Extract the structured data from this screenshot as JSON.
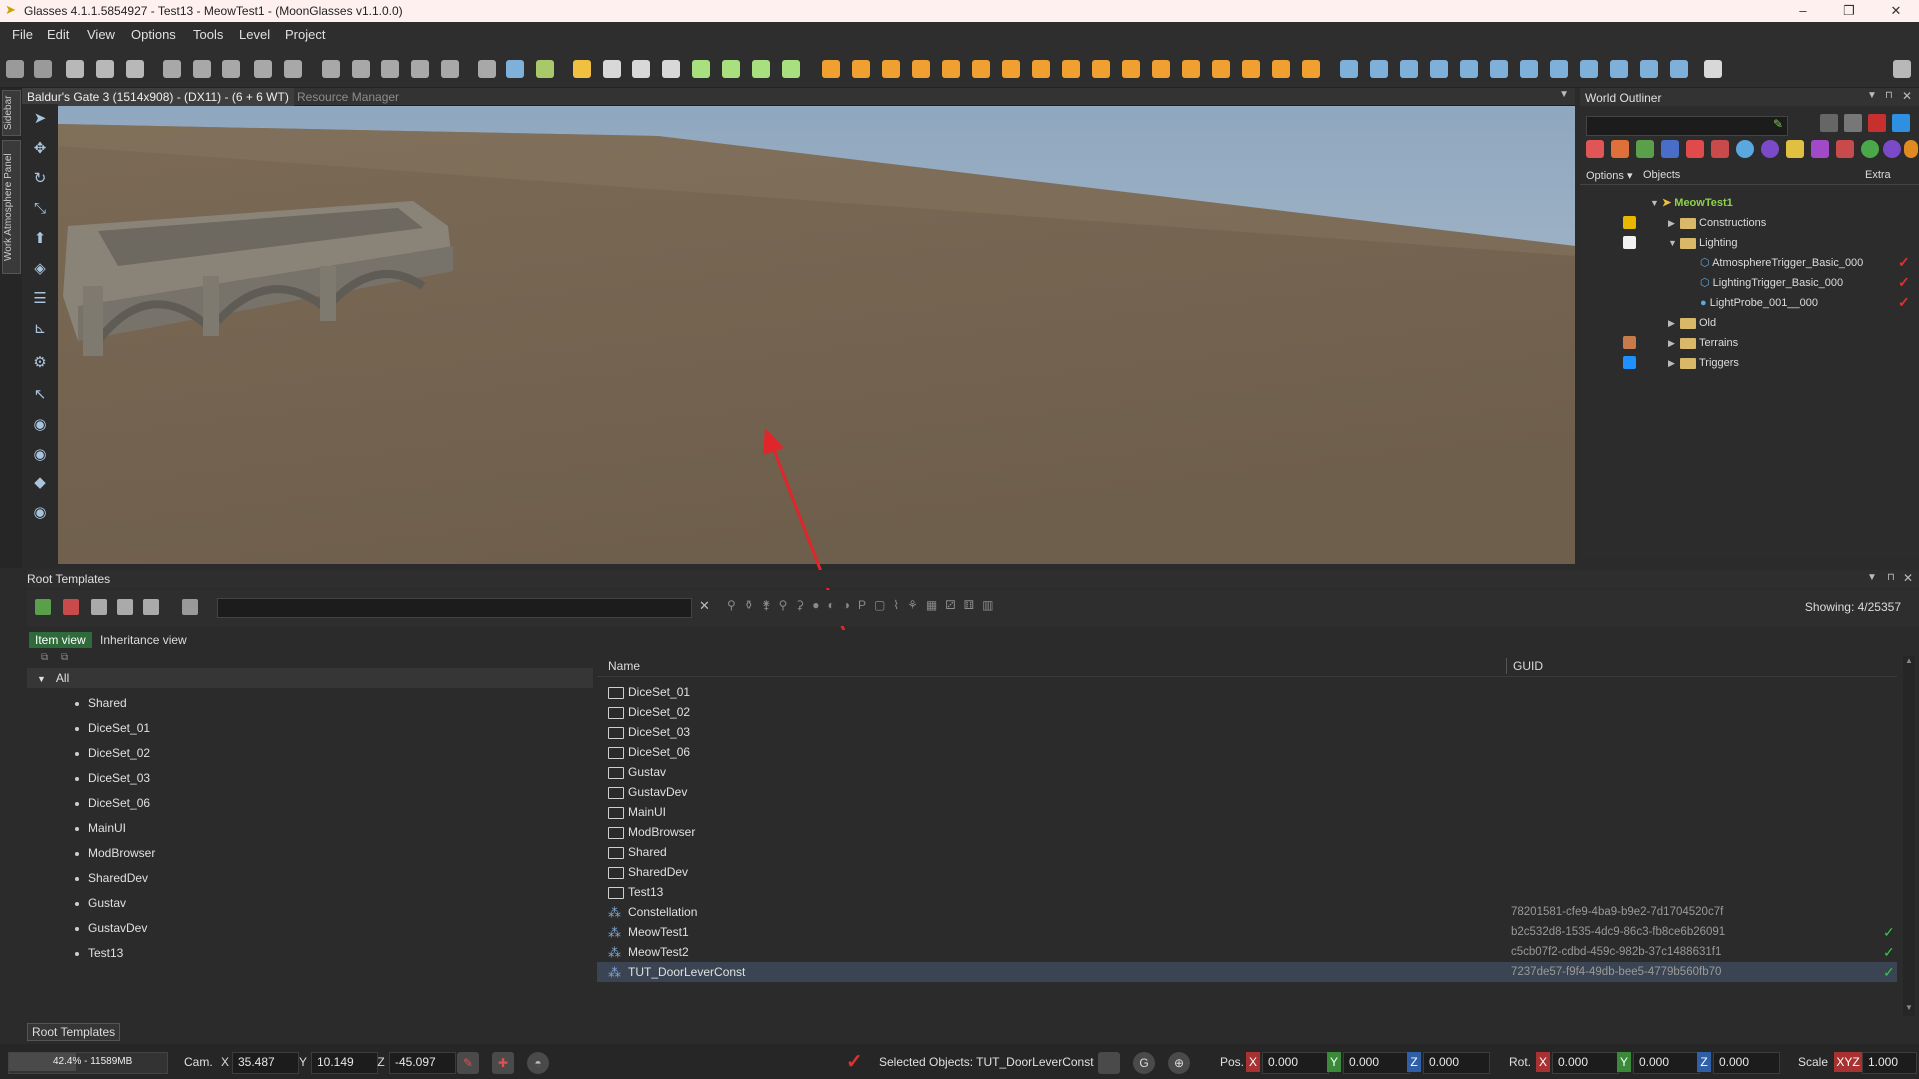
{
  "window": {
    "title": "Glasses 4.1.1.5854927 - Test13 - MeowTest1 - (MoonGlasses v1.1.0.0)",
    "minimize": "–",
    "maximize": "❐",
    "close": "✕"
  },
  "menu": [
    "File",
    "Edit",
    "View",
    "Options",
    "Tools",
    "Level",
    "Project"
  ],
  "sidebar_tabs": [
    "Sidebar",
    "Work Atmosphere Panel"
  ],
  "viewport": {
    "tab_active": "Baldur's Gate 3 (1514x908) - (DX11) - (6 + 6 WT)",
    "tab_other": "Resource Manager"
  },
  "outliner": {
    "title": "World Outliner",
    "options_label": "Options",
    "objects_label": "Objects",
    "extra_label": "Extra",
    "root": "MeowTest1",
    "items": {
      "constructions": "Constructions",
      "lighting": "Lighting",
      "atmosphere_trigger": "AtmosphereTrigger_Basic_000",
      "lighting_trigger": "LightingTrigger_Basic_000",
      "light_probe": "LightProbe_001__000",
      "old": "Old",
      "terrains": "Terrains",
      "triggers": "Triggers"
    },
    "colors": {
      "constructions": "#e8b800",
      "lighting": "#f2f2f2",
      "terrains": "#c77b4a",
      "triggers": "#1e90ff"
    }
  },
  "root_templates": {
    "title": "Root Templates",
    "showing": "Showing: 4/25357",
    "view_tabs": {
      "item": "Item view",
      "inheritance": "Inheritance view"
    },
    "footer_tab": "Root Templates",
    "tree": {
      "root": "All",
      "items": [
        "Shared",
        "DiceSet_01",
        "DiceSet_02",
        "DiceSet_03",
        "DiceSet_06",
        "MainUI",
        "ModBrowser",
        "SharedDev",
        "Gustav",
        "GustavDev",
        "Test13"
      ]
    },
    "columns": {
      "name": "Name",
      "guid": "GUID"
    },
    "folders": [
      "DiceSet_01",
      "DiceSet_02",
      "DiceSet_03",
      "DiceSet_06",
      "Gustav",
      "GustavDev",
      "MainUI",
      "ModBrowser",
      "Shared",
      "SharedDev",
      "Test13"
    ],
    "entries": [
      {
        "name": "Constellation",
        "guid": "78201581-cfe9-4ba9-b9e2-7d1704520c7f",
        "checked": ""
      },
      {
        "name": "MeowTest1",
        "guid": "b2c532d8-1535-4dc9-86c3-fb8ce6b26091",
        "checked": "✓"
      },
      {
        "name": "MeowTest2",
        "guid": "c5cb07f2-cdbd-459c-982b-37c1488631f1",
        "checked": "✓"
      },
      {
        "name": "TUT_DoorLeverConst",
        "guid": "7237de57-f9f4-49db-bee5-4779b560fb70",
        "checked": "✓"
      }
    ]
  },
  "status": {
    "memory": "42.4% - 11589MB",
    "cam_label": "Cam.",
    "cam": {
      "x": "35.487",
      "y": "10.149",
      "z": "-45.097"
    },
    "selected": "Selected Objects: TUT_DoorLeverConst",
    "pos_label": "Pos.",
    "pos": {
      "x": "0.000",
      "y": "0.000",
      "z": "0.000"
    },
    "rot_label": "Rot.",
    "rot": {
      "x": "0.000",
      "y": "0.000",
      "z": "0.000"
    },
    "scale_label": "Scale",
    "scale_axis": "XYZ",
    "scale": "1.000",
    "axis_x": "X",
    "axis_y": "Y",
    "axis_z": "Z"
  }
}
